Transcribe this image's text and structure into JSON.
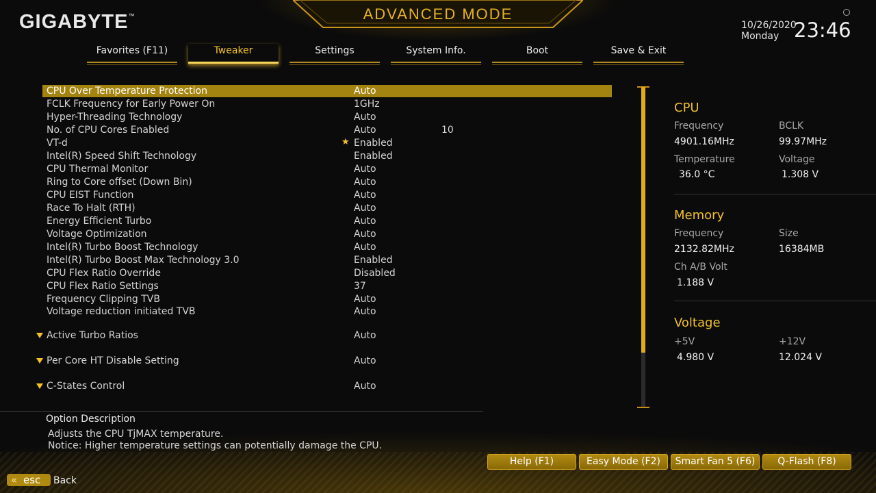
{
  "header": {
    "logo": "GIGABYTE",
    "logo_tm": "™",
    "mode_title": "ADVANCED MODE",
    "date": "10/26/2020",
    "weekday": "Monday",
    "time": "23:46"
  },
  "tabs": [
    {
      "label": "Favorites (F11)"
    },
    {
      "label": "Tweaker",
      "active": true
    },
    {
      "label": "Settings"
    },
    {
      "label": "System Info."
    },
    {
      "label": "Boot"
    },
    {
      "label": "Save & Exit"
    }
  ],
  "settings": [
    {
      "label": "CPU Over Temperature Protection",
      "value": "Auto",
      "selected": true
    },
    {
      "label": "FCLK Frequency for Early Power On",
      "value": "1GHz"
    },
    {
      "label": "Hyper-Threading Technology",
      "value": "Auto"
    },
    {
      "label": "No. of CPU Cores Enabled",
      "value": "Auto",
      "extra": "10"
    },
    {
      "label": "VT-d",
      "value": "Enabled",
      "starred": true
    },
    {
      "label": "Intel(R) Speed Shift Technology",
      "value": "Enabled"
    },
    {
      "label": "CPU Thermal Monitor",
      "value": "Auto"
    },
    {
      "label": "Ring to Core offset (Down Bin)",
      "value": "Auto"
    },
    {
      "label": "CPU EIST Function",
      "value": "Auto"
    },
    {
      "label": "Race To Halt (RTH)",
      "value": "Auto"
    },
    {
      "label": "Energy Efficient Turbo",
      "value": "Auto"
    },
    {
      "label": "Voltage Optimization",
      "value": "Auto"
    },
    {
      "label": "Intel(R) Turbo Boost Technology",
      "value": "Auto"
    },
    {
      "label": "Intel(R) Turbo Boost Max Technology 3.0",
      "value": "Enabled"
    },
    {
      "label": "CPU Flex Ratio Override",
      "value": "Disabled"
    },
    {
      "label": "CPU Flex Ratio Settings",
      "value": "37"
    },
    {
      "label": "Frequency Clipping TVB",
      "value": "Auto"
    },
    {
      "label": "Voltage reduction initiated TVB",
      "value": "Auto"
    }
  ],
  "submenus": [
    {
      "label": "Active Turbo Ratios",
      "value": "Auto"
    },
    {
      "label": "Per Core HT Disable Setting",
      "value": "Auto"
    },
    {
      "label": "C-States Control",
      "value": "Auto"
    }
  ],
  "scrollbar": {
    "visible_fraction": 0.83
  },
  "monitor": {
    "cpu": {
      "title": "CPU",
      "frequency_label": "Frequency",
      "frequency": "4901.16MHz",
      "bclk_label": "BCLK",
      "bclk": "99.97MHz",
      "temperature_label": "Temperature",
      "temperature": "36.0 °C",
      "voltage_label": "Voltage",
      "voltage": "1.308 V"
    },
    "memory": {
      "title": "Memory",
      "frequency_label": "Frequency",
      "frequency": "2132.82MHz",
      "size_label": "Size",
      "size": "16384MB",
      "volt_label": "Ch A/B Volt",
      "volt": "1.188 V"
    },
    "voltage": {
      "title": "Voltage",
      "p5v_label": "+5V",
      "p5v": "4.980 V",
      "p12v_label": "+12V",
      "p12v": "12.024 V"
    }
  },
  "description": {
    "title": "Option Description",
    "line1": "Adjusts the CPU TjMAX temperature.",
    "line2": "Notice: Higher temperature settings can potentially damage the CPU."
  },
  "footer": {
    "buttons": [
      "Help (F1)",
      "Easy Mode (F2)",
      "Smart Fan 5 (F6)",
      "Q-Flash (F8)"
    ],
    "esc_chevron": "«",
    "esc_label": "esc",
    "back_label": "Back"
  },
  "colors": {
    "accent": "#f2c12a",
    "selection": "#a48410",
    "scroll": "#e6a91e"
  }
}
